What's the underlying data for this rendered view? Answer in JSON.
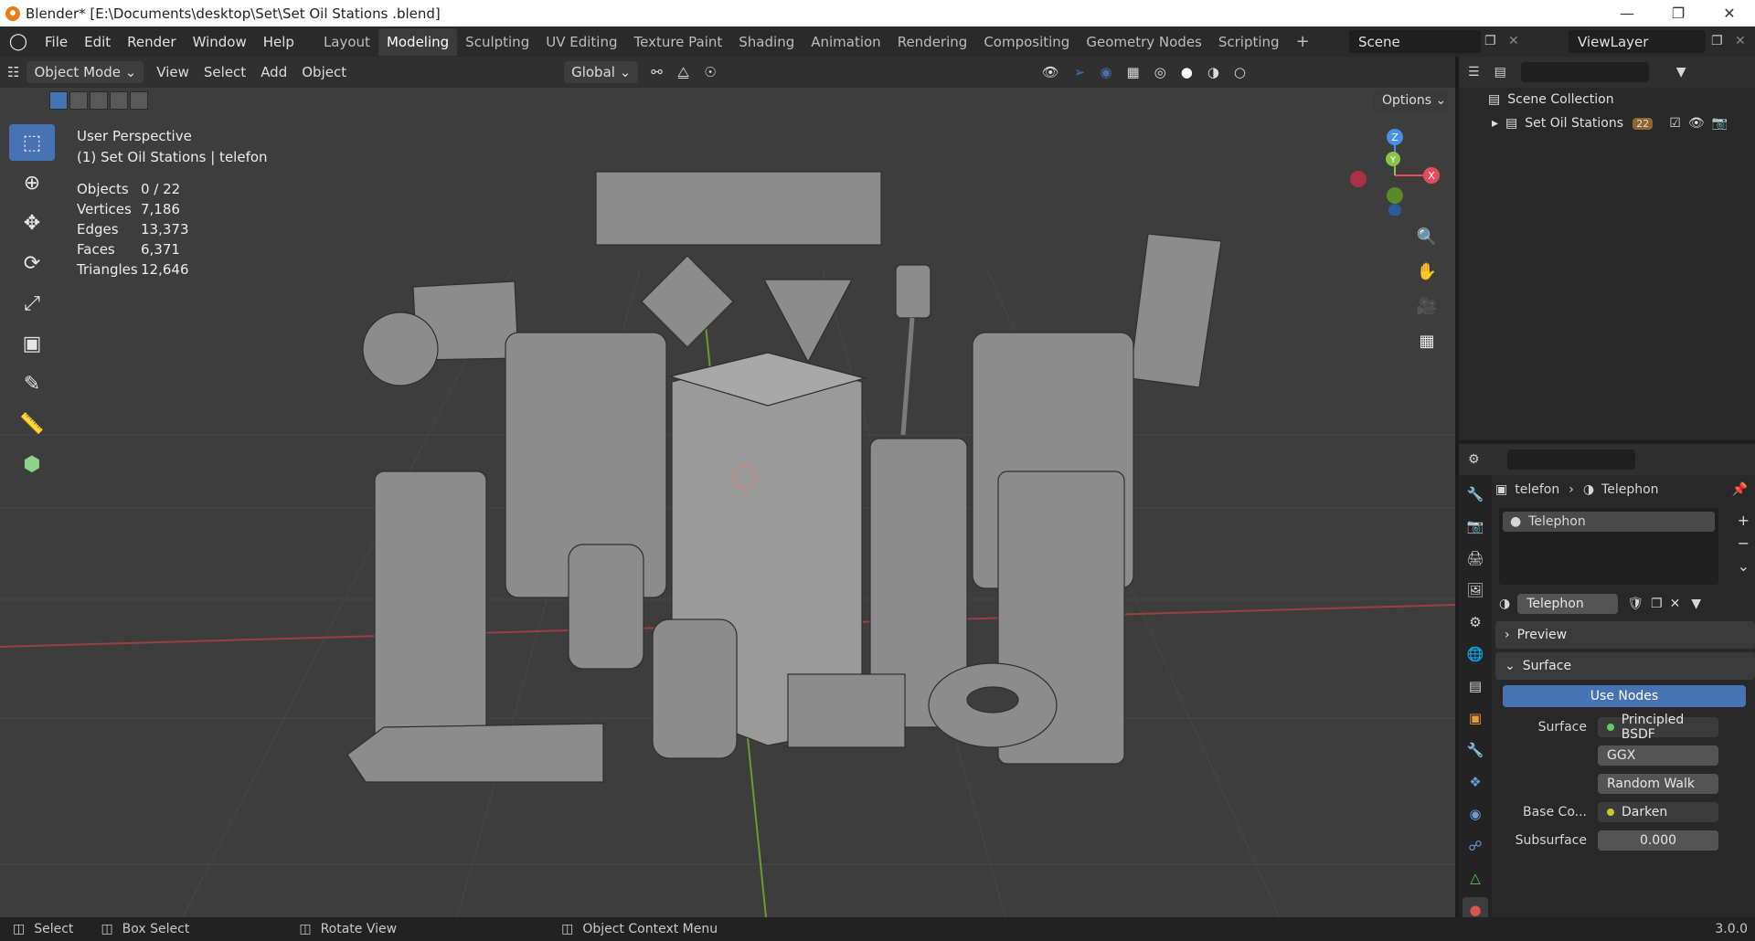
{
  "title": "Blender* [E:\\Documents\\desktop\\Set\\Set Oil Stations .blend]",
  "menus": [
    "File",
    "Edit",
    "Render",
    "Window",
    "Help"
  ],
  "workspaces": [
    "Layout",
    "Modeling",
    "Sculpting",
    "UV Editing",
    "Texture Paint",
    "Shading",
    "Animation",
    "Rendering",
    "Compositing",
    "Geometry Nodes",
    "Scripting"
  ],
  "active_workspace": "Modeling",
  "scene": "Scene",
  "view_layer": "ViewLayer",
  "viewport_header": {
    "mode": "Object Mode",
    "menus": [
      "View",
      "Select",
      "Add",
      "Object"
    ],
    "orientation": "Global",
    "options": "Options"
  },
  "viewport": {
    "perspective": "User Perspective",
    "collection": "(1) Set Oil Stations  | telefon",
    "stats": [
      {
        "label": "Objects",
        "value": "0 / 22"
      },
      {
        "label": "Vertices",
        "value": "7,186"
      },
      {
        "label": "Edges",
        "value": "13,373"
      },
      {
        "label": "Faces",
        "value": "6,371"
      },
      {
        "label": "Triangles",
        "value": "12,646"
      }
    ]
  },
  "outliner": {
    "scene_collection": "Scene Collection",
    "collection": "Set Oil Stations",
    "badge_count": "22"
  },
  "properties": {
    "object": "telefon",
    "material": "Telephon",
    "slot": "Telephon",
    "datablock": "Telephon",
    "preview": "Preview",
    "surface_panel": "Surface",
    "use_nodes": "Use Nodes",
    "surface_label": "Surface",
    "surface_value": "Principled BSDF",
    "distribution": "GGX",
    "subsurface_method": "Random Walk",
    "base_color_label": "Base Co...",
    "base_color_value": "Darken",
    "subsurface_label": "Subsurface",
    "subsurface_value": "0.000"
  },
  "statusbar": {
    "select": "Select",
    "box_select": "Box Select",
    "rotate": "Rotate View",
    "context": "Object Context Menu",
    "version": "3.0.0"
  },
  "colors": {
    "accent": "#4772b3",
    "axis_x": "#e74b5c",
    "axis_y": "#8bc34a",
    "axis_z": "#4a8fe7"
  }
}
